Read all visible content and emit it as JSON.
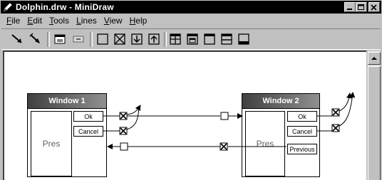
{
  "window": {
    "title": "Dolphin.drw - MiniDraw"
  },
  "menu": {
    "items": [
      "File",
      "Edit",
      "Tools",
      "Lines",
      "View",
      "Help"
    ]
  },
  "diagram": {
    "window1": {
      "title": "Window 1",
      "pres": "Pres",
      "buttons": [
        "Ok",
        "Cancel"
      ]
    },
    "window2": {
      "title": "Window 2",
      "pres": "Pres",
      "buttons": [
        "Ok",
        "Cancel",
        "Previous"
      ]
    }
  }
}
